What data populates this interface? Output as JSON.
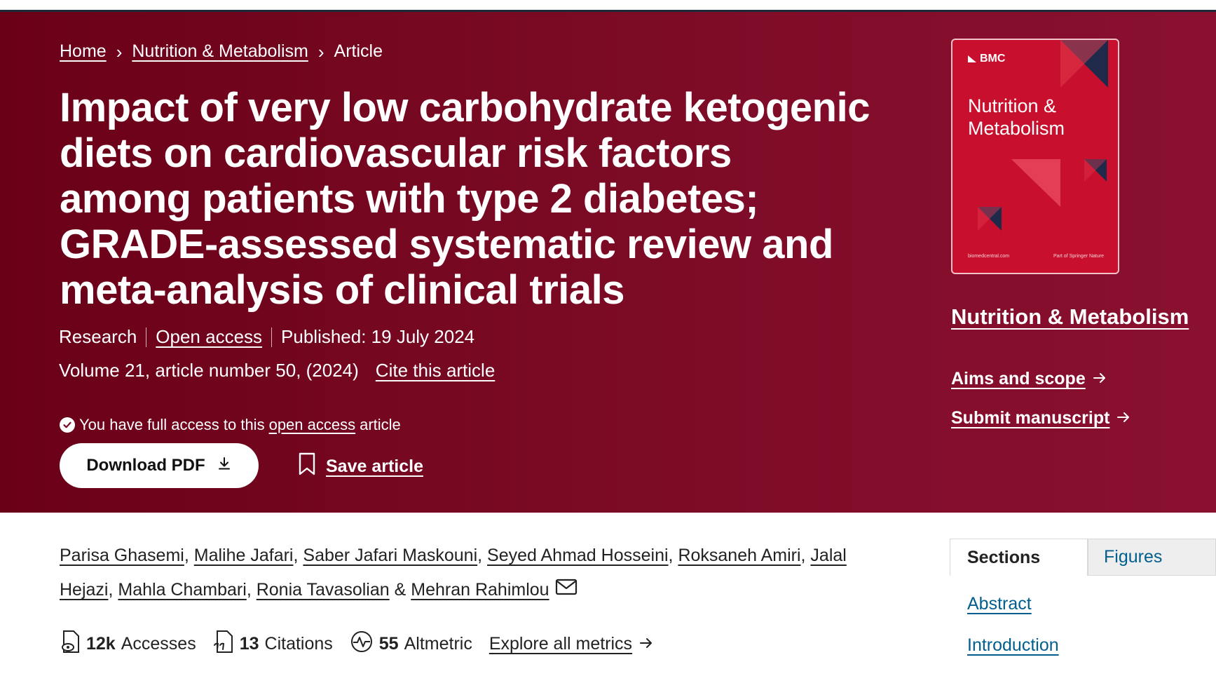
{
  "breadcrumb": {
    "home": "Home",
    "journal": "Nutrition & Metabolism",
    "current": "Article"
  },
  "article": {
    "title": "Impact of very low carbohydrate ketogenic diets on cardiovascular risk factors among patients with type 2 diabetes; GRADE-assessed systematic review and meta-analysis of clinical trials",
    "type": "Research",
    "open_access": "Open access",
    "published": "Published: 19 July 2024",
    "volume": "Volume 21, article number 50, (2024)",
    "cite": "Cite this article"
  },
  "access_note": {
    "prefix": "You have full access to this",
    "link": "open access",
    "suffix": "article"
  },
  "actions": {
    "download_pdf": "Download PDF",
    "save_article": "Save article"
  },
  "cover": {
    "brand": "BMC",
    "title_line1": "Nutrition &",
    "title_line2": "Metabolism",
    "footer_left": "biomedcentral.com",
    "footer_right": "Part of Springer Nature"
  },
  "sidebar": {
    "journal_name": "Nutrition & Metabolism",
    "aims_scope": "Aims and scope",
    "submit": "Submit manuscript"
  },
  "authors": [
    "Parisa Ghasemi",
    "Malihe Jafari",
    "Saber Jafari Maskouni",
    "Seyed Ahmad Hosseini",
    "Roksaneh Amiri",
    "Jalal Hejazi",
    "Mahla Chambari",
    "Ronia Tavasolian",
    "Mehran Rahimlou"
  ],
  "metrics": {
    "accesses_num": "12k",
    "accesses_label": "Accesses",
    "citations_num": "13",
    "citations_label": "Citations",
    "altmetric_num": "55",
    "altmetric_label": "Altmetric",
    "explore": "Explore all metrics"
  },
  "tabs": {
    "sections": "Sections",
    "figures": "Figures"
  },
  "sections_nav": {
    "abstract": "Abstract",
    "introduction": "Introduction"
  },
  "colors": {
    "hero_bg": "#7a0a24",
    "link_blue": "#025e8d",
    "cover_red": "#c8102e",
    "cover_navy": "#1f2a4a"
  }
}
